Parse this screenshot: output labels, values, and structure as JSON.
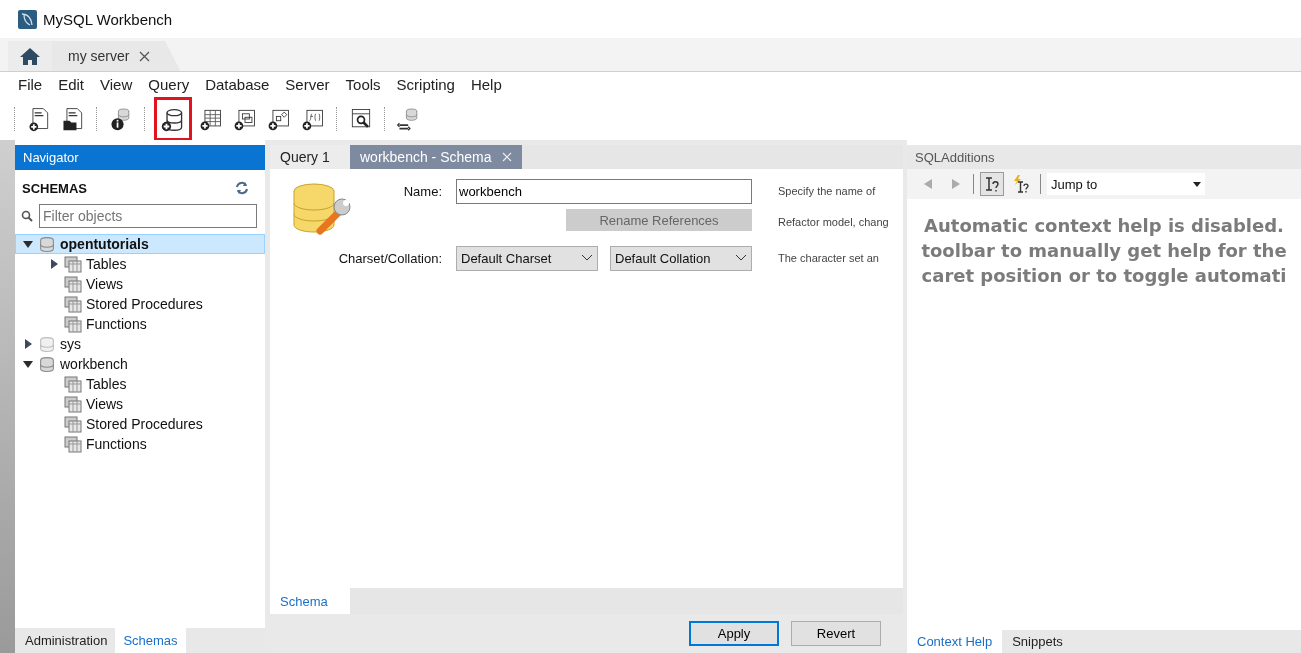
{
  "window": {
    "title": "MySQL Workbench"
  },
  "connection_tabs": [
    {
      "label": "my server",
      "selected": true
    }
  ],
  "menu": [
    "File",
    "Edit",
    "View",
    "Query",
    "Database",
    "Server",
    "Tools",
    "Scripting",
    "Help"
  ],
  "toolbar": [
    {
      "highlighted": false
    },
    {
      "highlighted": false
    },
    {
      "highlighted": false
    },
    {
      "highlighted": true
    },
    {
      "highlighted": false
    },
    {
      "highlighted": false
    },
    {
      "highlighted": false
    },
    {
      "highlighted": false
    },
    {
      "highlighted": false
    },
    {
      "highlighted": false
    }
  ],
  "navigator": {
    "title": "Navigator",
    "section": "SCHEMAS",
    "filter": {
      "placeholder": "Filter objects"
    },
    "tree": [
      {
        "label": "opentutorials",
        "kind": "schema",
        "expandable": true,
        "expanded": true,
        "selected": true,
        "loaded": true,
        "children": [
          {
            "label": "Tables",
            "kind": "folder",
            "expandable": true,
            "expanded": false,
            "selected": false
          },
          {
            "label": "Views",
            "kind": "folder",
            "expandable": false,
            "selected": false
          },
          {
            "label": "Stored Procedures",
            "kind": "folder",
            "expandable": false,
            "selected": false
          },
          {
            "label": "Functions",
            "kind": "folder",
            "expandable": false,
            "selected": false
          }
        ]
      },
      {
        "label": "sys",
        "kind": "schema",
        "expandable": true,
        "expanded": false,
        "selected": false,
        "loaded": false
      },
      {
        "label": "workbench",
        "kind": "schema",
        "expandable": true,
        "expanded": true,
        "selected": false,
        "loaded": true,
        "children": [
          {
            "label": "Tables",
            "kind": "folder",
            "expandable": false,
            "selected": false
          },
          {
            "label": "Views",
            "kind": "folder",
            "expandable": false,
            "selected": false
          },
          {
            "label": "Stored Procedures",
            "kind": "folder",
            "expandable": false,
            "selected": false
          },
          {
            "label": "Functions",
            "kind": "folder",
            "expandable": false,
            "selected": false
          }
        ]
      }
    ],
    "bottom_tabs": [
      {
        "label": "Administration",
        "selected": false
      },
      {
        "label": "Schemas",
        "selected": true
      }
    ]
  },
  "editor": {
    "tabs": [
      {
        "label": "Query 1",
        "selected": false,
        "closable": false
      },
      {
        "label": "workbench - Schema",
        "selected": true,
        "closable": true
      }
    ],
    "name_label": "Name:",
    "name_value": "workbench",
    "rename_button": "Rename References",
    "charset_label": "Charset/Collation:",
    "charset": "Default Charset",
    "collation": "Default Collation",
    "notes": [
      "Specify the name of",
      "Refactor model, chang",
      "The character set an"
    ],
    "bottom_tabs": [
      {
        "label": "Schema",
        "selected": true
      }
    ],
    "buttons": [
      "Apply",
      "Revert"
    ]
  },
  "sql_additions": {
    "title": "SQLAdditions",
    "jump_to": "Jump to",
    "help_lines": [
      "Automatic context help is disabled.",
      "toolbar to manually get help for the",
      "caret position or to toggle automati"
    ],
    "bottom_tabs": [
      {
        "label": "Context Help",
        "selected": true
      },
      {
        "label": "Snippets",
        "selected": false
      }
    ]
  }
}
